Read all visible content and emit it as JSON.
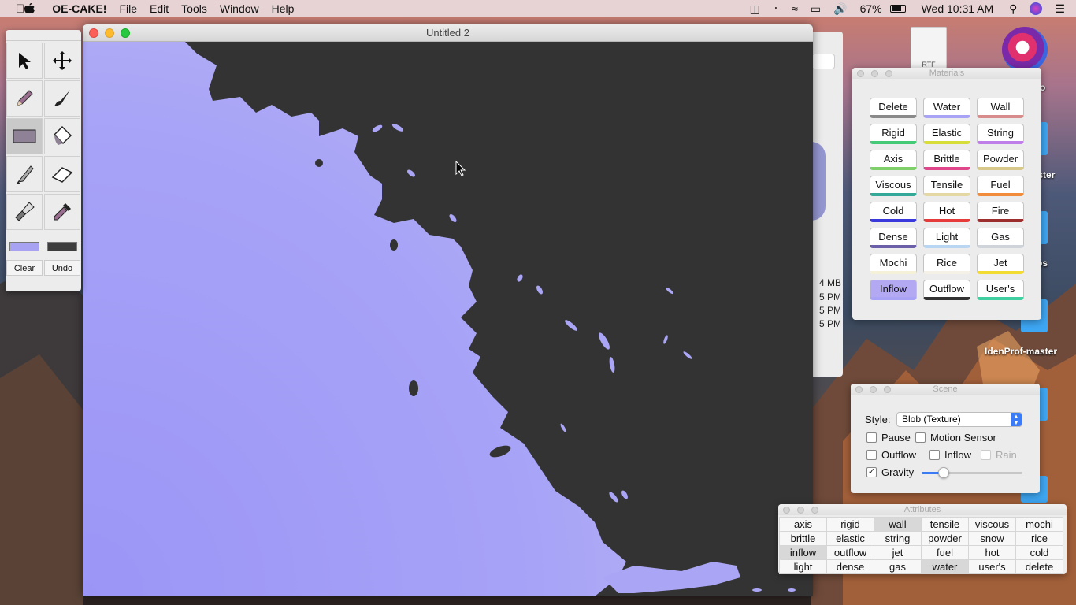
{
  "menubar": {
    "apple": "",
    "app_name": "OE-CAKE!",
    "menus": [
      "File",
      "Edit",
      "Tools",
      "Window",
      "Help"
    ],
    "battery": "67%",
    "clock": "Wed 10:31 AM"
  },
  "main_window": {
    "title": "Untitled 2"
  },
  "tools_palette": {
    "tools": [
      "select-arrow",
      "move-cross",
      "pencil",
      "brush",
      "rectangle",
      "paint-bucket",
      "knife",
      "eraser",
      "flashlight",
      "eyedropper"
    ],
    "selected_tool": "rectangle",
    "fg_color": "#a7a2f1",
    "bg_color": "#3d3d3d",
    "clear_label": "Clear",
    "undo_label": "Undo"
  },
  "materials": {
    "title": "Materials",
    "buttons": [
      {
        "label": "Delete",
        "color": "#8a8a8a"
      },
      {
        "label": "Water",
        "color": "#a9a3f5"
      },
      {
        "label": "Wall",
        "color": "#d88c8c"
      },
      {
        "label": "Rigid",
        "color": "#44c976"
      },
      {
        "label": "Elastic",
        "color": "#d7de3a"
      },
      {
        "label": "String",
        "color": "#c07ee8"
      },
      {
        "label": "Axis",
        "color": "#7fd06a"
      },
      {
        "label": "Brittle",
        "color": "#e0468a"
      },
      {
        "label": "Powder",
        "color": "#d8c88c"
      },
      {
        "label": "Viscous",
        "color": "#34a99a"
      },
      {
        "label": "Tensile",
        "color": "#e6d8a4"
      },
      {
        "label": "Fuel",
        "color": "#f08c3c"
      },
      {
        "label": "Cold",
        "color": "#3a3adc"
      },
      {
        "label": "Hot",
        "color": "#e53b3b"
      },
      {
        "label": "Fire",
        "color": "#9c2e2e"
      },
      {
        "label": "Dense",
        "color": "#6b5fa8"
      },
      {
        "label": "Light",
        "color": "#b8d6f2"
      },
      {
        "label": "Gas",
        "color": "#cfd4da"
      },
      {
        "label": "Mochi",
        "color": "#f5f0d8"
      },
      {
        "label": "Rice",
        "color": "#f5f1e6"
      },
      {
        "label": "Jet",
        "color": "#f2dc34"
      },
      {
        "label": "Inflow",
        "color": "#a9a3f5",
        "active": true
      },
      {
        "label": "Outflow",
        "color": "#333333"
      },
      {
        "label": "User's",
        "color": "#3fcfa0"
      }
    ]
  },
  "scene": {
    "title": "Scene",
    "style_label": "Style:",
    "style_value": "Blob (Texture)",
    "pause_label": "Pause",
    "motion_label": "Motion Sensor",
    "outflow_label": "Outflow",
    "inflow_label": "Inflow",
    "rain_label": "Rain",
    "gravity_label": "Gravity",
    "gravity_level": 0.22
  },
  "attributes": {
    "title": "Attributes",
    "rows": [
      [
        "axis",
        "rigid",
        "wall",
        "tensile",
        "viscous",
        "mochi"
      ],
      [
        "brittle",
        "elastic",
        "string",
        "powder",
        "snow",
        "rice"
      ],
      [
        "inflow",
        "outflow",
        "jet",
        "fuel",
        "hot",
        "cold"
      ],
      [
        "light",
        "dense",
        "gas",
        "water",
        "user's",
        "delete"
      ]
    ],
    "highlighted": [
      "wall",
      "inflow",
      "water"
    ]
  },
  "behind_window": {
    "size_text": "4 MB",
    "times": [
      "5 PM",
      "5 PM",
      "5 PM"
    ]
  },
  "desktop": {
    "file_icon_label": "RTF",
    "labels": [
      "master",
      "ps",
      "IdenProf-master",
      "o"
    ]
  }
}
